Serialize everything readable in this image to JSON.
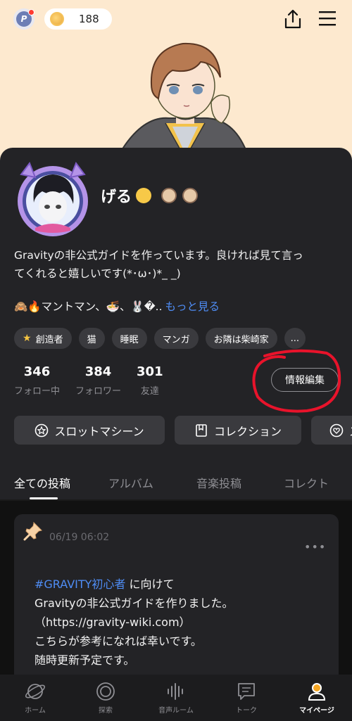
{
  "header": {
    "coin_count": "188",
    "icons": [
      "p-badge-icon",
      "coin-icon",
      "share-icon",
      "menu-icon"
    ]
  },
  "profile": {
    "name": "げる",
    "bio_line1": "Gravityの非公式ガイドを作っています。良ければ見て言っ",
    "bio_line2": "てくれると嬉しいです(*･ω･)*_ _)",
    "tagline": "🙈🔥マントマン、🍜、🐰�..",
    "more_link": "もっと見る",
    "tags": [
      "創造者",
      "猫",
      "睡眠",
      "マンガ",
      "お隣は柴崎家",
      "..."
    ],
    "stats": [
      {
        "value": "346",
        "label": "フォロー中"
      },
      {
        "value": "384",
        "label": "フォロワー"
      },
      {
        "value": "301",
        "label": "友達"
      }
    ],
    "edit_button": "情報編集",
    "actions": [
      "スロットマシーン",
      "コレクション",
      "ス"
    ]
  },
  "tabs": [
    "全ての投稿",
    "アルバム",
    "音楽投稿",
    "コレクト"
  ],
  "post": {
    "date": "06/19 06:02",
    "hashtag": "#GRAVITY初心者",
    "line1_rest": " に向けて",
    "line2": "Gravityの非公式ガイドを作りました。",
    "line3": "（https://gravity-wiki.com）",
    "line4": "こちらが参考になれば幸いです。",
    "line5": "随時更新予定です。"
  },
  "nav": [
    {
      "label": "ホーム",
      "icon": "planet-icon"
    },
    {
      "label": "探索",
      "icon": "explore-icon"
    },
    {
      "label": "音声ルーム",
      "icon": "audio-wave-icon"
    },
    {
      "label": "トーク",
      "icon": "chat-icon"
    },
    {
      "label": "マイページ",
      "icon": "profile-icon"
    }
  ],
  "colors": {
    "accent": "#4f8df5",
    "card": "#232326",
    "hero": "#fde9cf",
    "annotation": "#e8132b"
  }
}
